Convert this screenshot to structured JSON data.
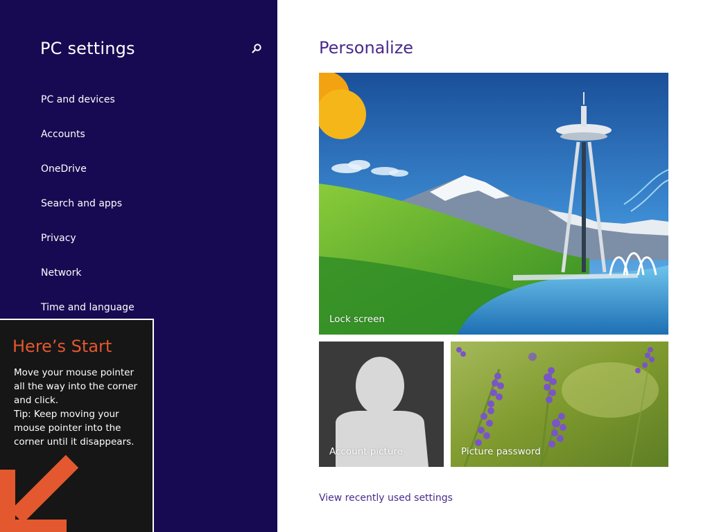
{
  "sidebar": {
    "title": "PC settings",
    "search_icon": "search-icon",
    "items": [
      {
        "label": "PC and devices"
      },
      {
        "label": "Accounts"
      },
      {
        "label": "OneDrive"
      },
      {
        "label": "Search and apps"
      },
      {
        "label": "Privacy"
      },
      {
        "label": "Network"
      },
      {
        "label": "Time and language"
      }
    ],
    "background_color": "#180a52"
  },
  "tip": {
    "title": "Here’s Start",
    "lines": [
      "Move your mouse pointer",
      "all the way into the corner",
      "and click.",
      "Tip: Keep moving your",
      "mouse pointer into the",
      "corner until it disappears."
    ],
    "arrow_icon": "arrow-down-left-icon",
    "accent_color": "#e3582e"
  },
  "main": {
    "title": "Personalize",
    "tiles": [
      {
        "label": "Lock screen"
      },
      {
        "label": "Account picture"
      },
      {
        "label": "Picture password"
      }
    ],
    "recent_link": "View recently used settings",
    "accent_color": "#4a2a8c"
  }
}
